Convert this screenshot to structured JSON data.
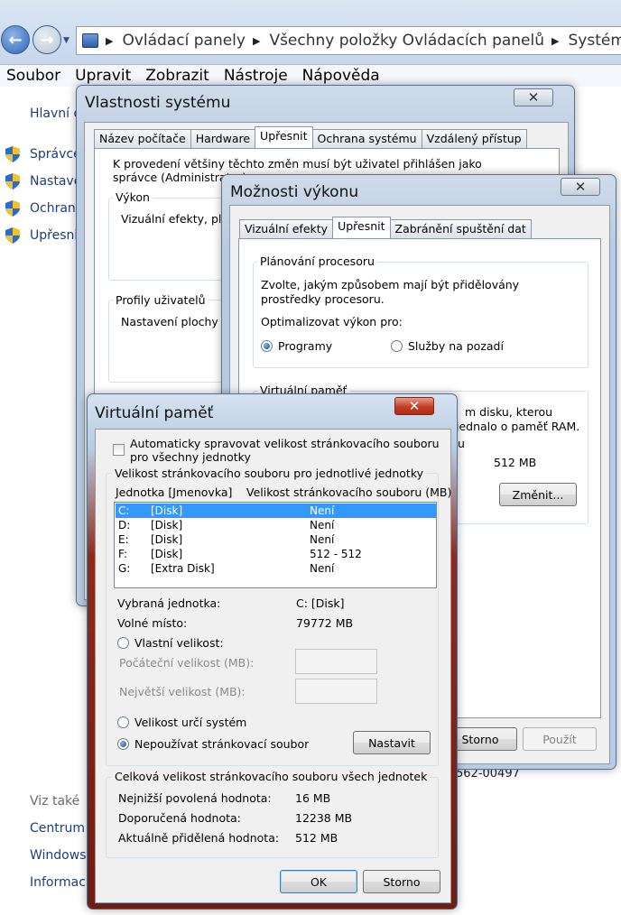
{
  "explorer": {
    "breadcrumb": [
      "Ovládací panely",
      "Všechny položky Ovládacích panelů",
      "Systém"
    ],
    "menu": [
      "Soubor",
      "Upravit",
      "Zobrazit",
      "Nástroje",
      "Nápověda"
    ],
    "side": {
      "home": "Hlavní o",
      "links": [
        "Správce",
        "Nastave",
        "Ochrana",
        "Upřesni"
      ],
      "see_also": "Viz také",
      "see_links": [
        "Centrum",
        "Windows",
        "Informac"
      ]
    },
    "fragment_product_id": "562-00497"
  },
  "sysprops": {
    "title": "Vlastnosti systému",
    "tabs": [
      "Název počítače",
      "Hardware",
      "Upřesnit",
      "Ochrana systému",
      "Vzdálený přístup"
    ],
    "admin_note": "K provedení většiny těchto změn musí být uživatel přihlášen jako správce (Administrator).",
    "performance_label": "Výkon",
    "performance_text": "Vizuální efekty, plá",
    "profiles_label": "Profily uživatelů",
    "profiles_text": "Nastavení plochy v"
  },
  "perf": {
    "title": "Možnosti výkonu",
    "tabs": [
      "Vizuální efekty",
      "Upřesnit",
      "Zabránění spuštění dat"
    ],
    "sched_label": "Plánování procesoru",
    "sched_text": "Zvolte, jakým způsobem mají být přidělovány prostředky procesoru.",
    "optimize_label": "Optimalizovat výkon pro:",
    "opt_programs": "Programy",
    "opt_services": "Služby na pozadí",
    "vm_label": "Virtuální paměť",
    "vm_frag1": "m disku, kterou",
    "vm_frag2": "jednalo o paměť RAM.",
    "vm_frag3": "u",
    "vm_size": "512 MB",
    "change_button": "Změnit...",
    "cancel_button": "Storno",
    "apply_button": "Použít"
  },
  "vm": {
    "title": "Virtuální paměť",
    "auto_manage": "Automaticky spravovat velikost stránkovacího souboru pro všechny jednotky",
    "per_drive_label": "Velikost stránkovacího souboru pro jednotlivé jednotky",
    "col_drive": "Jednotka [Jmenovka]",
    "col_size": "Velikost stránkovacího souboru (MB)",
    "drives": [
      {
        "letter": "C:",
        "label": "[Disk]",
        "size": "Není"
      },
      {
        "letter": "D:",
        "label": "[Disk]",
        "size": "Není"
      },
      {
        "letter": "E:",
        "label": "[Disk]",
        "size": "Není"
      },
      {
        "letter": "F:",
        "label": "[Disk]",
        "size": "512 - 512"
      },
      {
        "letter": "G:",
        "label": "[Extra Disk]",
        "size": "Není"
      }
    ],
    "selected_drive_label": "Vybraná jednotka:",
    "selected_drive_value": "C:  [Disk]",
    "free_space_label": "Volné místo:",
    "free_space_value": "79772 MB",
    "custom_size": "Vlastní velikost:",
    "initial_size": "Počáteční velikost (MB):",
    "max_size": "Největší velikost (MB):",
    "system_managed": "Velikost určí systém",
    "no_paging": "Nepoužívat stránkovací soubor",
    "set_button": "Nastavit",
    "total_label": "Celková velikost stránkovacího souboru všech jednotek",
    "min_label": "Nejnižší povolená hodnota:",
    "min_value": "16 MB",
    "rec_label": "Doporučená hodnota:",
    "rec_value": "12238 MB",
    "cur_label": "Aktuálně přidělená hodnota:",
    "cur_value": "512 MB",
    "ok_button": "OK",
    "cancel_button": "Storno"
  },
  "colors": {
    "selection": "#3399ff",
    "link": "#1c3f7a"
  }
}
